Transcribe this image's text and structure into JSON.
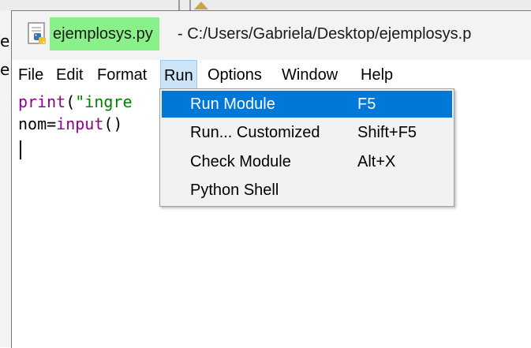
{
  "background_window": {
    "fragments": [
      "er",
      "e"
    ]
  },
  "window": {
    "title_file": "ejemplosys.py",
    "title_path": " - C:/Users/Gabriela/Desktop/ejemplosys.p"
  },
  "menubar": {
    "items": [
      "File",
      "Edit",
      "Format",
      "Run",
      "Options",
      "Window",
      "Help"
    ],
    "active": "Run"
  },
  "editor": {
    "line1": {
      "keyword": "print",
      "rest": "(\"ingr",
      "string_part": "\"ingr"
    },
    "line1_prefix": "print",
    "line1_paren": "(",
    "line1_string": "\"ingre",
    "line2_prefix": "nom=",
    "line2_keyword": "input",
    "line2_suffix": "()"
  },
  "run_menu": {
    "items": [
      {
        "label": "Run Module",
        "shortcut": "F5",
        "highlighted": true
      },
      {
        "label": "Run... Customized",
        "shortcut": "Shift+F5",
        "highlighted": false
      },
      {
        "label": "Check Module",
        "shortcut": "Alt+X",
        "highlighted": false
      },
      {
        "label": "Python Shell",
        "shortcut": "",
        "highlighted": false
      }
    ]
  },
  "colors": {
    "title_highlight": "#8af089",
    "menu_active": "#cce4f7",
    "menu_highlight": "#0078d7",
    "keyword": "#900090",
    "string": "#008000"
  }
}
